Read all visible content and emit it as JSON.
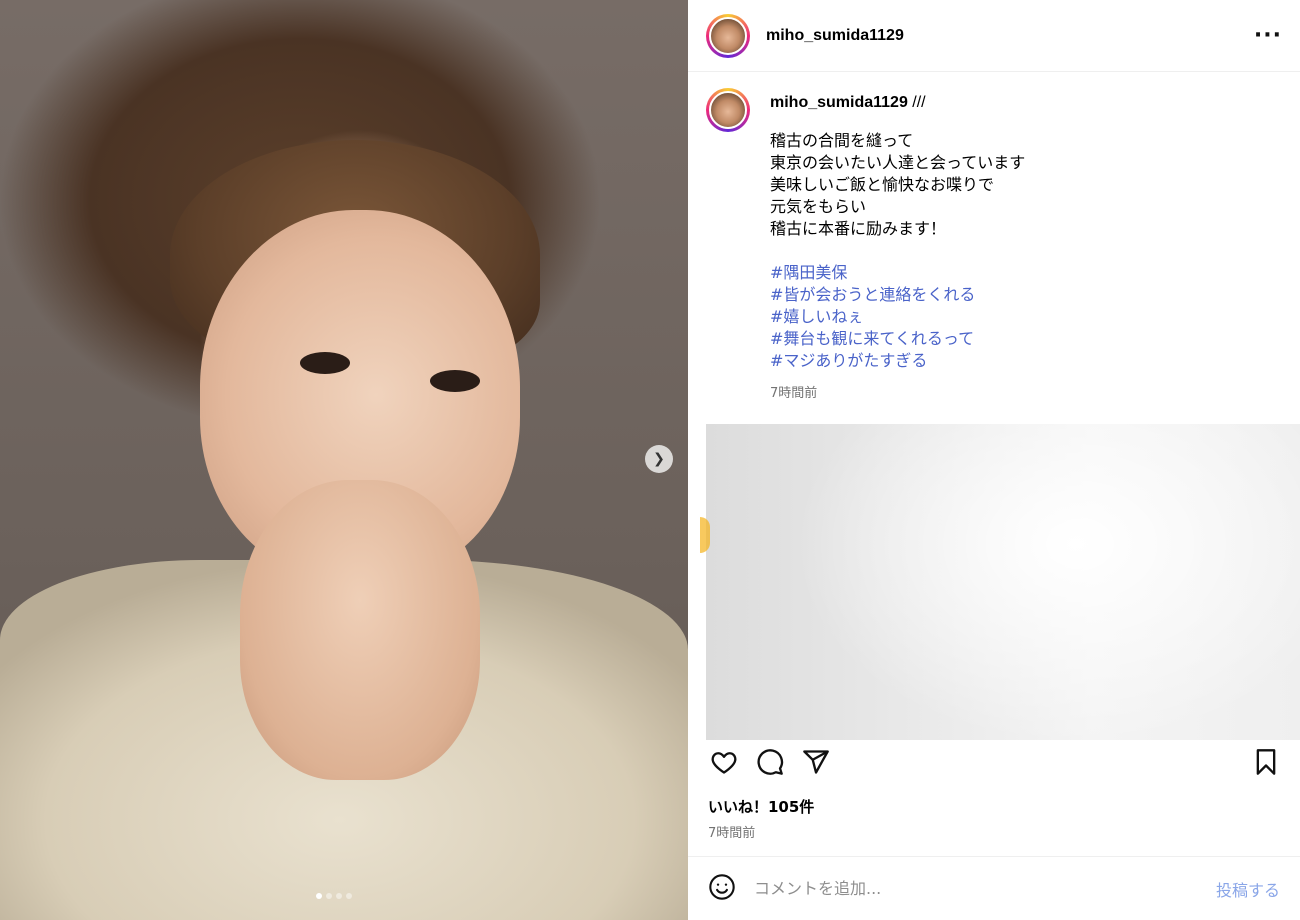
{
  "post": {
    "username": "miho_sumida1129",
    "more_icon": "more-icon"
  },
  "caption": {
    "username": "miho_sumida1129",
    "suffix": " ///",
    "text": "稽古の合間を縫って\n東京の会いたい人達と会っています\n美味しいご飯と愉快なお喋りで\n元気をもらい\n稽古に本番に励みます！",
    "hashtags": [
      "#隅田美保",
      "#皆が会おうと連絡をくれる",
      "#嬉しいねぇ",
      "#舞台も観に来てくれるって",
      "#マジありがたすぎる"
    ],
    "time": "7時間前"
  },
  "engagement": {
    "likes": "いいね！105件",
    "time": "7時間前"
  },
  "comment": {
    "placeholder": "コメントを追加...",
    "post_label": "投稿する"
  },
  "carousel": {
    "total": 4,
    "active": 0
  },
  "colors": {
    "hashtag": "#4a63c9",
    "post_button": "#8aa6e8",
    "muted": "#737373"
  }
}
